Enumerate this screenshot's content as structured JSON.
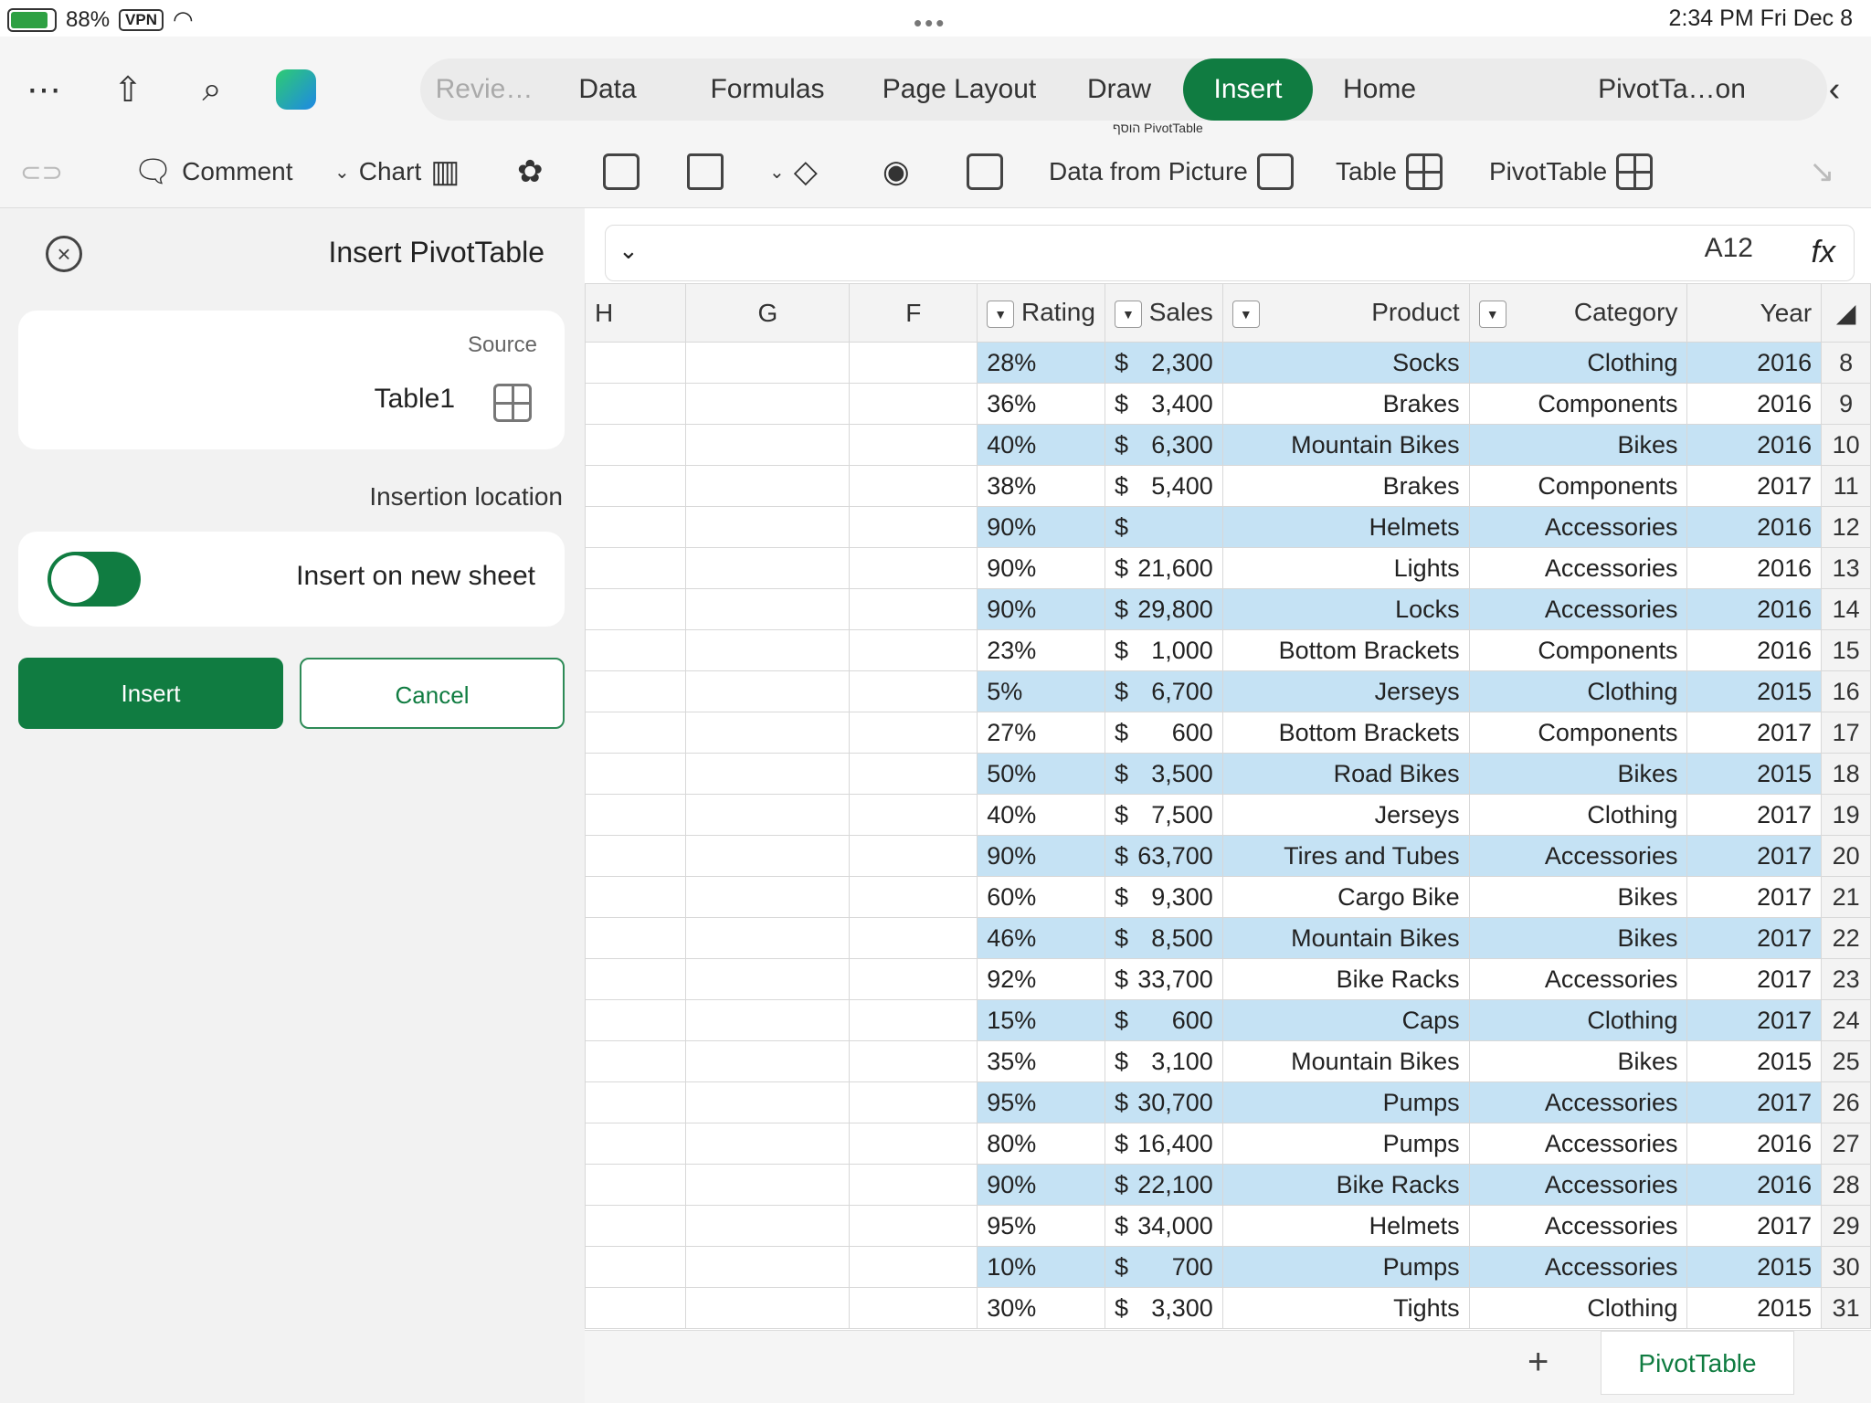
{
  "status": {
    "battery": "88%",
    "vpn": "VPN",
    "time": "2:34 PM  Fri Dec 8"
  },
  "nav": {
    "tabs": [
      {
        "label": "Revie…"
      },
      {
        "label": "Data"
      },
      {
        "label": "Formulas"
      },
      {
        "label": "Page Layout"
      },
      {
        "label": "Draw"
      },
      {
        "label": "Insert"
      },
      {
        "label": "Home"
      },
      {
        "label": "PivotTa…on"
      }
    ],
    "hint_above_ribbon": "הוסף PivotTable"
  },
  "ribbon": {
    "buttons": [
      {
        "label": "Comment"
      },
      {
        "label": "Chart"
      },
      {
        "label": "Data from Picture"
      },
      {
        "label": "Table"
      },
      {
        "label": "PivotTable"
      }
    ]
  },
  "panel": {
    "title": "Insert PivotTable",
    "source_label": "Source",
    "source_value": "Table1",
    "location_label": "Insertion location",
    "new_sheet_label": "Insert on new sheet",
    "insert_button": "Insert",
    "cancel_button": "Cancel"
  },
  "formula": {
    "fx": "fx",
    "cellref": "A12"
  },
  "grid": {
    "columns": [
      "Year",
      "Category",
      "Product",
      "Sales",
      "Rating",
      "F",
      "G",
      "H"
    ],
    "rows": [
      {
        "n": "8",
        "year": "2016",
        "cat": "Clothing",
        "prod": "Socks",
        "cur": "$",
        "sales": "2,300",
        "rating": "28%",
        "band": true
      },
      {
        "n": "9",
        "year": "2016",
        "cat": "Components",
        "prod": "Brakes",
        "cur": "$",
        "sales": "3,400",
        "rating": "36%",
        "band": false
      },
      {
        "n": "10",
        "year": "2016",
        "cat": "Bikes",
        "prod": "Mountain Bikes",
        "cur": "$",
        "sales": "6,300",
        "rating": "40%",
        "band": true
      },
      {
        "n": "11",
        "year": "2017",
        "cat": "Components",
        "prod": "Brakes",
        "cur": "$",
        "sales": "5,400",
        "rating": "38%",
        "band": false
      },
      {
        "n": "12",
        "year": "2016",
        "cat": "Accessories",
        "prod": "Helmets",
        "cur": "$",
        "sales": "",
        "rating": "90%",
        "band": true
      },
      {
        "n": "13",
        "year": "2016",
        "cat": "Accessories",
        "prod": "Lights",
        "cur": "$",
        "sales": "21,600",
        "rating": "90%",
        "band": false
      },
      {
        "n": "14",
        "year": "2016",
        "cat": "Accessories",
        "prod": "Locks",
        "cur": "$",
        "sales": "29,800",
        "rating": "90%",
        "band": true
      },
      {
        "n": "15",
        "year": "2016",
        "cat": "Components",
        "prod": "Bottom Brackets",
        "cur": "$",
        "sales": "1,000",
        "rating": "23%",
        "band": false
      },
      {
        "n": "16",
        "year": "2015",
        "cat": "Clothing",
        "prod": "Jerseys",
        "cur": "$",
        "sales": "6,700",
        "rating": "5%",
        "band": true
      },
      {
        "n": "17",
        "year": "2017",
        "cat": "Components",
        "prod": "Bottom Brackets",
        "cur": "$",
        "sales": "600",
        "rating": "27%",
        "band": false
      },
      {
        "n": "18",
        "year": "2015",
        "cat": "Bikes",
        "prod": "Road Bikes",
        "cur": "$",
        "sales": "3,500",
        "rating": "50%",
        "band": true
      },
      {
        "n": "19",
        "year": "2017",
        "cat": "Clothing",
        "prod": "Jerseys",
        "cur": "$",
        "sales": "7,500",
        "rating": "40%",
        "band": false
      },
      {
        "n": "20",
        "year": "2017",
        "cat": "Accessories",
        "prod": "Tires and Tubes",
        "cur": "$",
        "sales": "63,700",
        "rating": "90%",
        "band": true
      },
      {
        "n": "21",
        "year": "2017",
        "cat": "Bikes",
        "prod": "Cargo Bike",
        "cur": "$",
        "sales": "9,300",
        "rating": "60%",
        "band": false
      },
      {
        "n": "22",
        "year": "2017",
        "cat": "Bikes",
        "prod": "Mountain Bikes",
        "cur": "$",
        "sales": "8,500",
        "rating": "46%",
        "band": true
      },
      {
        "n": "23",
        "year": "2017",
        "cat": "Accessories",
        "prod": "Bike Racks",
        "cur": "$",
        "sales": "33,700",
        "rating": "92%",
        "band": false
      },
      {
        "n": "24",
        "year": "2017",
        "cat": "Clothing",
        "prod": "Caps",
        "cur": "$",
        "sales": "600",
        "rating": "15%",
        "band": true
      },
      {
        "n": "25",
        "year": "2015",
        "cat": "Bikes",
        "prod": "Mountain Bikes",
        "cur": "$",
        "sales": "3,100",
        "rating": "35%",
        "band": false
      },
      {
        "n": "26",
        "year": "2017",
        "cat": "Accessories",
        "prod": "Pumps",
        "cur": "$",
        "sales": "30,700",
        "rating": "95%",
        "band": true
      },
      {
        "n": "27",
        "year": "2016",
        "cat": "Accessories",
        "prod": "Pumps",
        "cur": "$",
        "sales": "16,400",
        "rating": "80%",
        "band": false
      },
      {
        "n": "28",
        "year": "2016",
        "cat": "Accessories",
        "prod": "Bike Racks",
        "cur": "$",
        "sales": "22,100",
        "rating": "90%",
        "band": true
      },
      {
        "n": "29",
        "year": "2017",
        "cat": "Accessories",
        "prod": "Helmets",
        "cur": "$",
        "sales": "34,000",
        "rating": "95%",
        "band": false
      },
      {
        "n": "30",
        "year": "2015",
        "cat": "Accessories",
        "prod": "Pumps",
        "cur": "$",
        "sales": "700",
        "rating": "10%",
        "band": true
      },
      {
        "n": "31",
        "year": "2015",
        "cat": "Clothing",
        "prod": "Tights",
        "cur": "$",
        "sales": "3,300",
        "rating": "30%",
        "band": false
      }
    ]
  },
  "sheets": {
    "tabs": [
      "PivotTable"
    ],
    "add": "+"
  },
  "colors": {
    "accent": "#107c41",
    "band": "#c5e2f4"
  }
}
